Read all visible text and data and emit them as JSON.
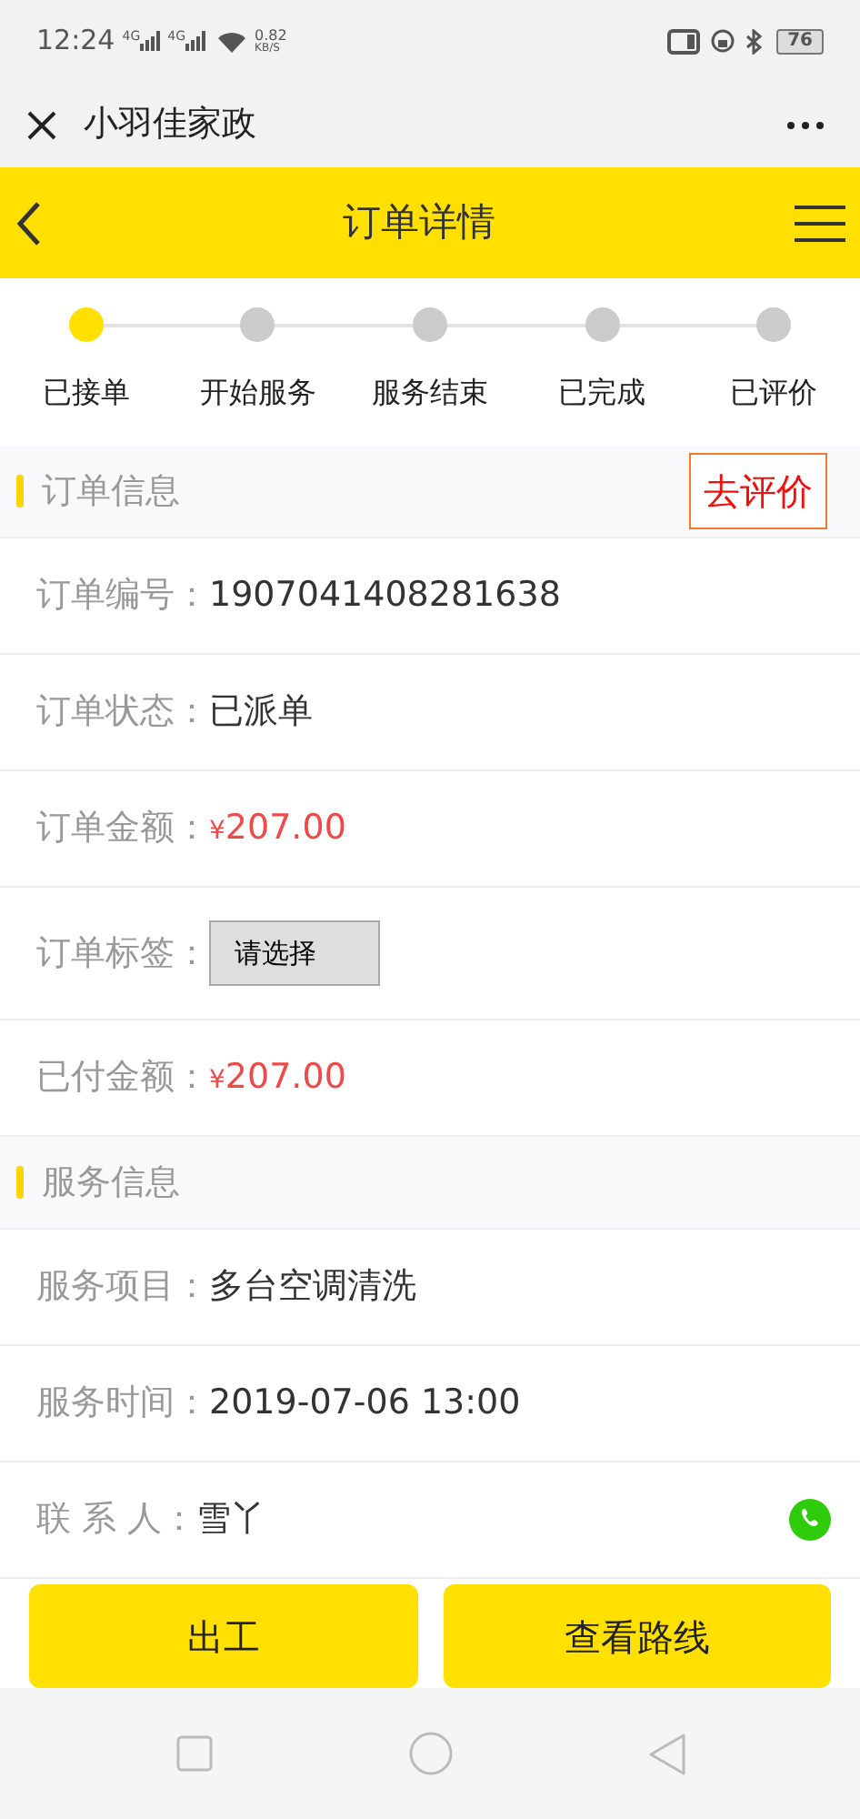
{
  "status_bar": {
    "time": "12:24",
    "signals": [
      "4G",
      "4G"
    ],
    "speed": "0.82",
    "speed_unit": "KB/S",
    "battery": "76"
  },
  "app_bar": {
    "title": "小羽佳家政"
  },
  "header": {
    "title": "订单详情"
  },
  "steps": [
    {
      "label": "已接单",
      "selected": true
    },
    {
      "label": "开始服务",
      "selected": false
    },
    {
      "label": "服务结束",
      "selected": false
    },
    {
      "label": "已完成",
      "selected": false
    },
    {
      "label": "已评价",
      "selected": false
    }
  ],
  "sections": [
    {
      "title": "订单信息",
      "action": "去评价",
      "rows": [
        {
          "kind": "text",
          "label": "订单编号：",
          "value": "1907041408281638"
        },
        {
          "kind": "text",
          "label": "订单状态：",
          "value": "已派单"
        },
        {
          "kind": "price",
          "label": "订单金额：",
          "value": "¥207.00"
        },
        {
          "kind": "select",
          "label": "订单标签：",
          "value": "请选择"
        },
        {
          "kind": "price",
          "label": "已付金额：",
          "value": "¥207.00"
        }
      ]
    },
    {
      "title": "服务信息",
      "rows": [
        {
          "kind": "text",
          "label": "服务项目：",
          "value": "多台空调清洗"
        },
        {
          "kind": "text",
          "label": "服务时间：",
          "value": "2019-07-06 13:00"
        },
        {
          "kind": "contact",
          "label": "联 系 人：",
          "value": "雪丫"
        }
      ]
    }
  ],
  "buttons": [
    "出工",
    "查看路线"
  ]
}
